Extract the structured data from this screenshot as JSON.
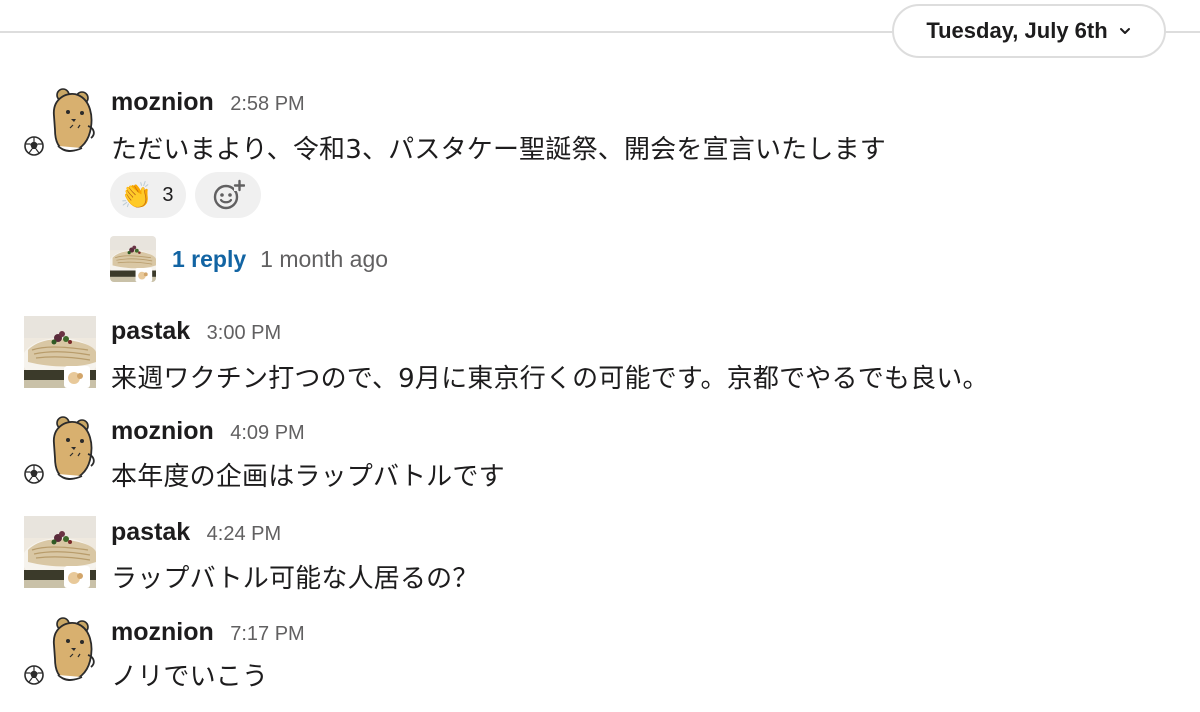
{
  "date_divider": {
    "label": "Tuesday, July 6th"
  },
  "messages": [
    {
      "user": "moznion",
      "time": "2:58 PM",
      "text": "ただいまより、令和3、パスタケー聖誕祭、開会を宣言いたします",
      "avatar": "bear-avatar"
    },
    {
      "user": "pastak",
      "time": "3:00 PM",
      "text": "来週ワクチン打つので、9月に東京行くの可能です。京都でやるでも良い。",
      "avatar": "pasta-avatar"
    },
    {
      "user": "moznion",
      "time": "4:09 PM",
      "text": "本年度の企画はラップバトルです",
      "avatar": "bear-avatar"
    },
    {
      "user": "pastak",
      "time": "4:24 PM",
      "text": "ラップバトル可能な人居るの？",
      "avatar": "pasta-avatar"
    },
    {
      "user": "moznion",
      "time": "7:17 PM",
      "text": "ノリでいこう",
      "avatar": "bear-avatar"
    }
  ],
  "reactions": [
    {
      "emoji": "👏",
      "count": "3",
      "icon": "clapping-hands-icon"
    },
    {
      "icon": "add-reaction-icon"
    }
  ],
  "thread": {
    "reply_label": "1 reply",
    "last_reply": "1 month ago"
  },
  "colors": {
    "link": "#1264a3",
    "muted": "#616061",
    "reaction_bg": "#f0f0f0",
    "divider": "#dddddd"
  }
}
